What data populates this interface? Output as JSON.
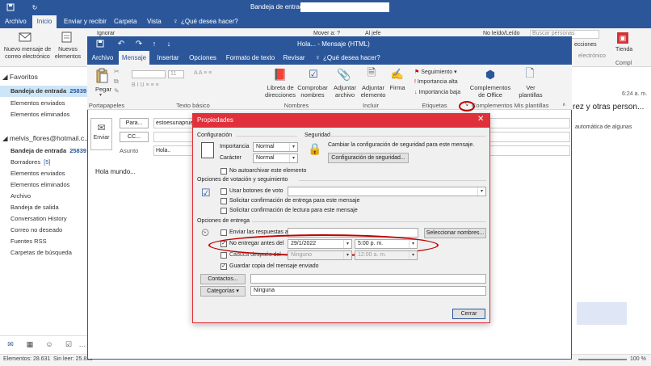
{
  "outlook": {
    "title": "Bandeja de entrada",
    "tabs": [
      "Archivo",
      "Inicio",
      "Enviar y recibir",
      "Carpeta",
      "Vista"
    ],
    "search": "¿Qué desea hacer?",
    "ribbon": {
      "new_email": "Nuevo mensaje de correo electrónico",
      "new_items": "Nuevos elementos",
      "ignore": "Ignorar",
      "move": "Mover a: ?",
      "to_boss": "Al jefe",
      "unread": "No leído/Leído",
      "search_people": "Buscar personas",
      "collections": "ecciones",
      "electronic": "electrónico",
      "store": "Tienda",
      "complements": "Compl"
    },
    "favorites_header": "Favoritos",
    "favorites": [
      {
        "label": "Bandeja de entrada",
        "count": "25839"
      },
      {
        "label": "Elementos enviados",
        "count": ""
      },
      {
        "label": "Elementos eliminados",
        "count": ""
      }
    ],
    "account": "melvis_flores@hotmail.c...",
    "folders": [
      {
        "label": "Bandeja de entrada",
        "count": "25839"
      },
      {
        "label": "Borradores",
        "count": "[5]"
      },
      {
        "label": "Elementos enviados",
        "count": ""
      },
      {
        "label": "Elementos eliminados",
        "count": ""
      },
      {
        "label": "Archivo",
        "count": ""
      },
      {
        "label": "Bandeja de salida",
        "count": ""
      },
      {
        "label": "Conversation History",
        "count": ""
      },
      {
        "label": "Correo no deseado",
        "count": ""
      },
      {
        "label": "Fuentes RSS",
        "count": ""
      },
      {
        "label": "Carpetas de búsqueda",
        "count": ""
      }
    ],
    "status_left": "Elementos: 28.631",
    "status_mid": "Sin leer: 25.839",
    "zoom": "100 %",
    "right_time": "6:24 a. m.",
    "right_text1": "rez y otras person...",
    "right_text2": "automática de algunas"
  },
  "message": {
    "title": "Hola... - Mensaje (HTML)",
    "tabs": [
      "Archivo",
      "Mensaje",
      "Insertar",
      "Opciones",
      "Formato de texto",
      "Revisar"
    ],
    "search": "¿Qué desea hacer?",
    "ribbon": {
      "paste": "Pegar",
      "clipboard": "Portapapeles",
      "font_size": "11",
      "basic_text": "Texto básico",
      "address_book": "Libreta de direcciones",
      "check_names": "Comprobar nombres",
      "names": "Nombres",
      "attach_file": "Adjuntar archivo",
      "attach_item": "Adjuntar elemento",
      "signature": "Firma",
      "include": "Incluir",
      "followup": "Seguimiento",
      "high_importance": "Importancia alta",
      "low_importance": "Importancia baja",
      "tags": "Etiquetas",
      "office_addins": "Complementos de Office",
      "complements": "Complementos",
      "view_templates": "Ver plantillas",
      "my_templates": "Mis plantillas"
    },
    "send": "Enviar",
    "to_label": "Para...",
    "to_value": "estoesunaprueba",
    "cc_label": "CC...",
    "subject_label": "Asunto",
    "subject_value": "Hola..",
    "body": "Hola mundo..."
  },
  "dialog": {
    "title": "Propiedades",
    "config_header": "Configuración",
    "importance_label": "Importancia",
    "importance_value": "Normal",
    "character_label": "Carácter",
    "character_value": "Normal",
    "security_header": "Seguridad",
    "security_text": "Cambiar la configuración de seguridad para este mensaje.",
    "security_button": "Configuración de seguridad...",
    "no_autoarchive": "No autoarchivar este elemento",
    "voting_header": "Opciones de votación y seguimiento",
    "use_voting": "Usar botones de voto",
    "delivery_receipt": "Solicitar confirmación de entrega para este mensaje",
    "read_receipt": "Solicitar confirmación de lectura para este mensaje",
    "delivery_header": "Opciones de entrega",
    "send_replies": "Enviar las respuestas a",
    "select_names": "Seleccionar nombres...",
    "do_not_deliver": "No entregar antes del",
    "deliver_date": "29/1/2022",
    "deliver_time": "5:00 p. m.",
    "expires": "Caduca después del",
    "expires_date": "Ninguno",
    "expires_time": "12:00 a. m.",
    "save_copy": "Guardar copia del mensaje enviado",
    "contacts": "Contactos...",
    "categories": "Categorías",
    "categories_value": "Ninguna",
    "close": "Cerrar"
  },
  "colors": {
    "outlook_blue": "#2b579a",
    "dark_blue": "#1f4e87",
    "dialog_red": "#e0303b",
    "highlight_red": "#c00000"
  }
}
